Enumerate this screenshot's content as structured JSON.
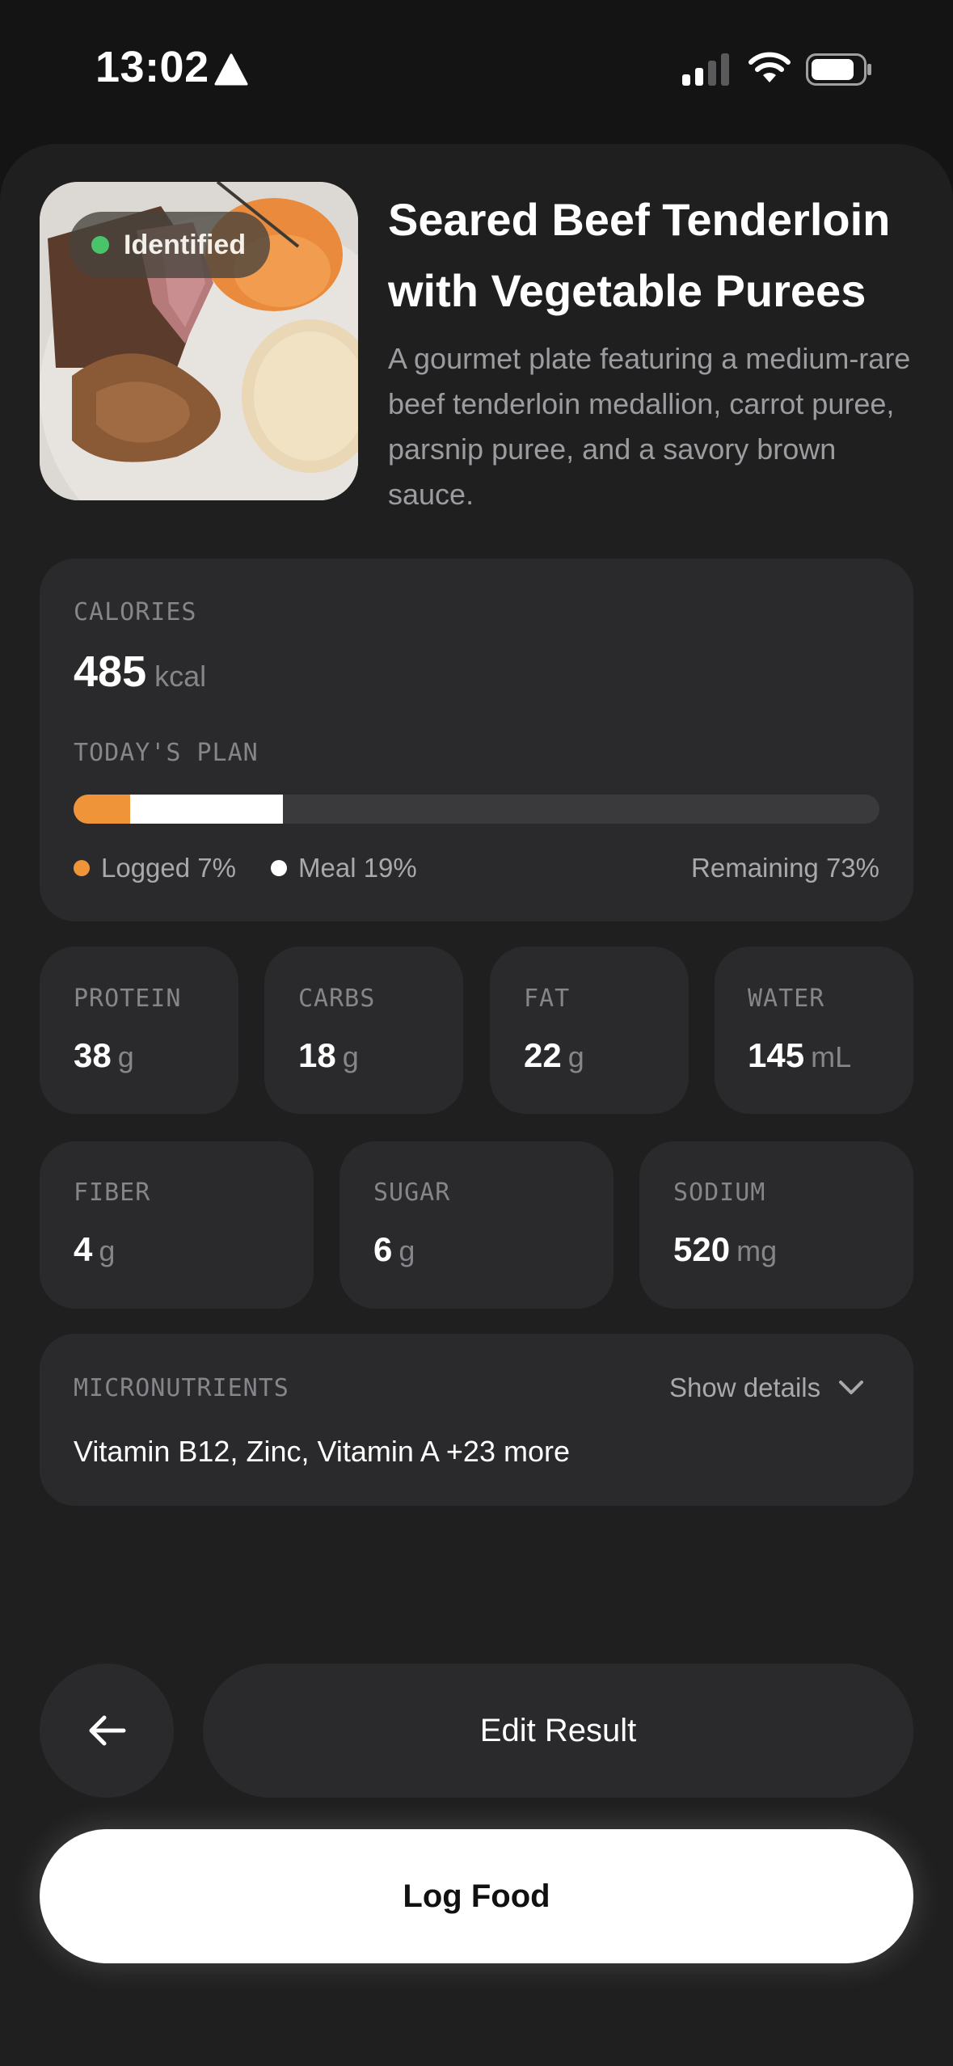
{
  "status_bar": {
    "time": "13:02"
  },
  "food": {
    "badge": "Identified",
    "title": "Seared Beef Tenderloin with Vegetable Purees",
    "description": "A gourmet plate featuring a medium-rare beef tenderloin medallion, carrot puree, parsnip puree, and a savory brown sauce."
  },
  "calories": {
    "label": "CALORIES",
    "value": "485",
    "unit": "kcal",
    "plan_label": "TODAY'S PLAN",
    "logged_pct": 7,
    "meal_pct": 19,
    "remaining_pct": 73,
    "logged_text": "Logged 7%",
    "meal_text": "Meal 19%",
    "remaining_text": "Remaining 73%"
  },
  "macros": [
    {
      "label": "PROTEIN",
      "value": "38",
      "unit": "g"
    },
    {
      "label": "CARBS",
      "value": "18",
      "unit": "g"
    },
    {
      "label": "FAT",
      "value": "22",
      "unit": "g"
    },
    {
      "label": "WATER",
      "value": "145",
      "unit": "mL"
    }
  ],
  "other": [
    {
      "label": "FIBER",
      "value": "4",
      "unit": "g"
    },
    {
      "label": "SUGAR",
      "value": "6",
      "unit": "g"
    },
    {
      "label": "SODIUM",
      "value": "520",
      "unit": "mg"
    }
  ],
  "micronutrients": {
    "label": "MICRONUTRIENTS",
    "toggle": "Show details",
    "summary": "Vitamin B12, Zinc, Vitamin A +23 more"
  },
  "actions": {
    "edit": "Edit Result",
    "log": "Log Food"
  },
  "colors": {
    "accent": "#f0943a",
    "identified": "#49c46a",
    "background": "#141414",
    "card": "#2a2a2c"
  },
  "icons": {
    "back": "arrow-left-icon",
    "expand": "chevron-down-icon"
  }
}
